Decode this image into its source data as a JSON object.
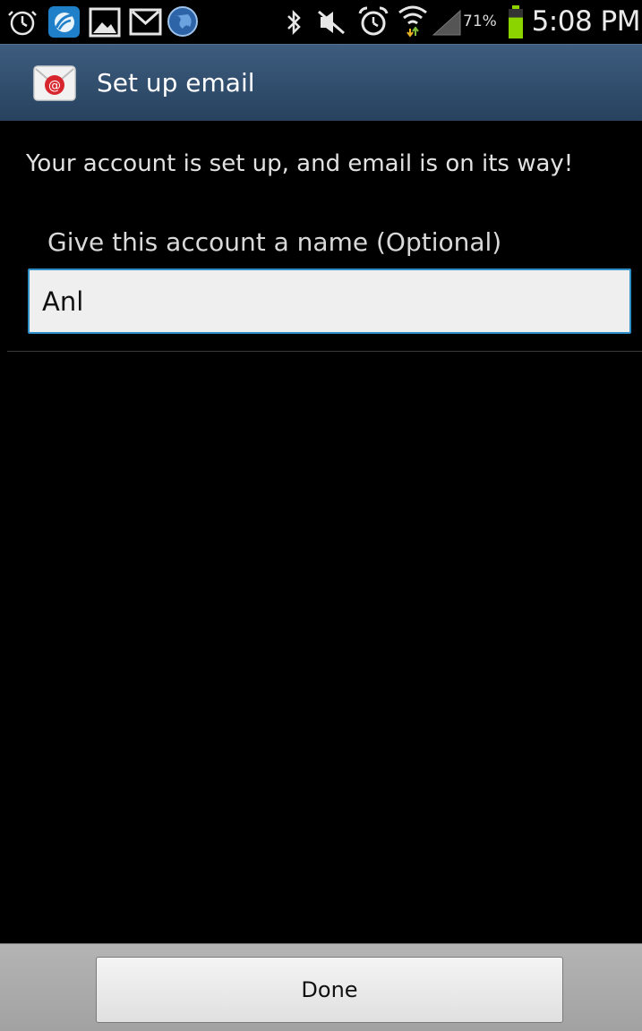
{
  "status_bar": {
    "time": "5:08 PM",
    "battery_percent": "71%",
    "battery_level": 0.71,
    "icons": [
      "alarm-icon",
      "wireless-hotspot-icon",
      "gallery-icon",
      "gmail-icon",
      "globe-icon",
      "bluetooth-icon",
      "mute-icon",
      "alarm-clock-icon",
      "wifi-icon",
      "signal-icon",
      "battery-icon"
    ],
    "battery_color": "#8bd400"
  },
  "title_bar": {
    "title": "Set up email",
    "background": "#2f4c6d"
  },
  "main": {
    "message": "Your account is set up, and email is on its way!",
    "name_field": {
      "label": "Give this account a name (Optional)",
      "value": "Anl",
      "border_color": "#2f8fc8"
    }
  },
  "footer": {
    "done_label": "Done"
  }
}
